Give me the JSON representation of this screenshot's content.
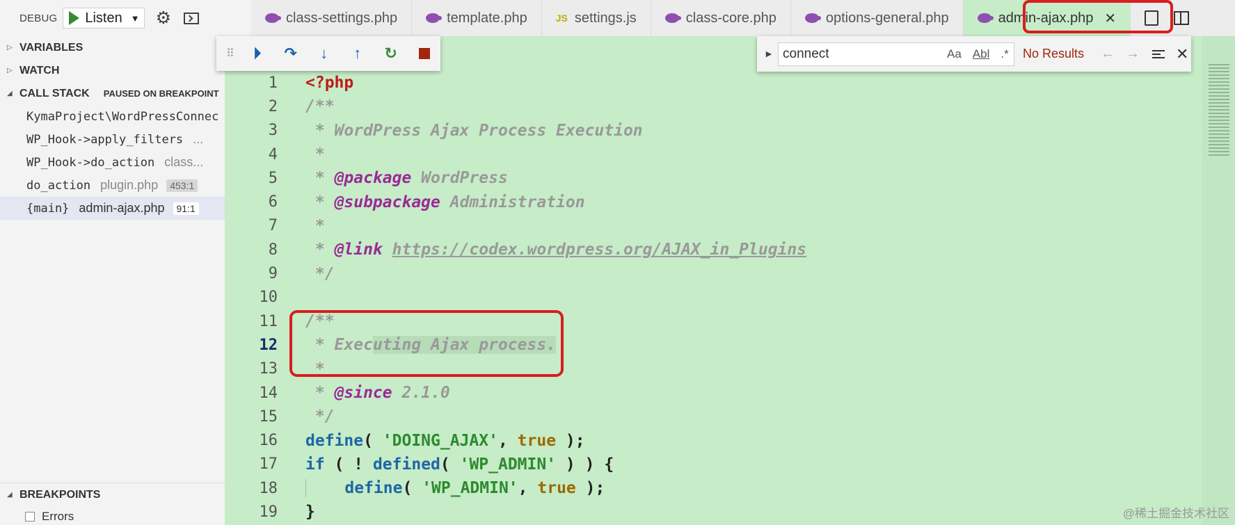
{
  "debug": {
    "label": "DEBUG",
    "config": "Listen"
  },
  "sections": {
    "variables": "VARIABLES",
    "watch": "WATCH",
    "call_stack": "CALL STACK",
    "paused": "PAUSED ON BREAKPOINT",
    "breakpoints": "BREAKPOINTS"
  },
  "call_stack": [
    {
      "fn": "KymaProject\\WordPressConnec",
      "file": "",
      "pos": ""
    },
    {
      "fn": "WP_Hook->apply_filters",
      "file": "...",
      "pos": ""
    },
    {
      "fn": "WP_Hook->do_action",
      "file": "class...",
      "pos": ""
    },
    {
      "fn": "do_action",
      "file": "plugin.php",
      "pos": "453:1"
    },
    {
      "fn": "{main}",
      "file": "admin-ajax.php",
      "pos": "91:1"
    }
  ],
  "breakpoints": [
    {
      "label": "Errors"
    }
  ],
  "tabs": [
    {
      "label": "class-settings.php"
    },
    {
      "label": "template.php"
    },
    {
      "label": "settings.js",
      "icon": "JS"
    },
    {
      "label": "class-core.php"
    },
    {
      "label": "options-general.php"
    },
    {
      "label": "admin-ajax.php"
    }
  ],
  "find": {
    "value": "connect",
    "opt_case": "Aa",
    "opt_word": "Abl",
    "opt_regex": ".*",
    "result": "No Results"
  },
  "code": {
    "line_numbers": [
      "1",
      "2",
      "3",
      "4",
      "5",
      "6",
      "7",
      "8",
      "9",
      "10",
      "11",
      "12",
      "13",
      "14",
      "15",
      "16",
      "17",
      "18",
      "19"
    ],
    "l1": "<?php",
    "l2": "/**",
    "l3": " * WordPress Ajax Process Execution",
    "l4": " *",
    "l5_star": " * ",
    "l5_tag": "@package",
    "l5_val": " WordPress",
    "l6_star": " * ",
    "l6_tag": "@subpackage",
    "l6_val": " Administration",
    "l7": " *",
    "l8_star": " * ",
    "l8_tag": "@link",
    "l8_url": "https://codex.wordpress.org/AJAX_in_Plugins",
    "l9": " */",
    "l11": "/**",
    "l12_a": " * Exec",
    "l12_b": "uting Ajax process.",
    "l13": " *",
    "l14_star": " * ",
    "l14_tag": "@since",
    "l14_val": " 2.1.0",
    "l15": " */",
    "l16_fn": "define",
    "l16_a": "( ",
    "l16_str": "'DOING_AJAX'",
    "l16_b": ", ",
    "l16_bool": "true",
    "l16_c": " );",
    "l17_kw": "if",
    "l17_a": " ( ! ",
    "l17_fn": "defined",
    "l17_b": "( ",
    "l17_str": "'WP_ADMIN'",
    "l17_c": " ) ) {",
    "l18_fn": "define",
    "l18_a": "( ",
    "l18_str": "'WP_ADMIN'",
    "l18_b": ", ",
    "l18_bool": "true",
    "l18_c": " );",
    "l19": "}"
  },
  "watermark": "@稀土掘金技术社区",
  "colors": {
    "editor_bg": "#c6ecc8",
    "highlight_red": "#d81e1e"
  }
}
